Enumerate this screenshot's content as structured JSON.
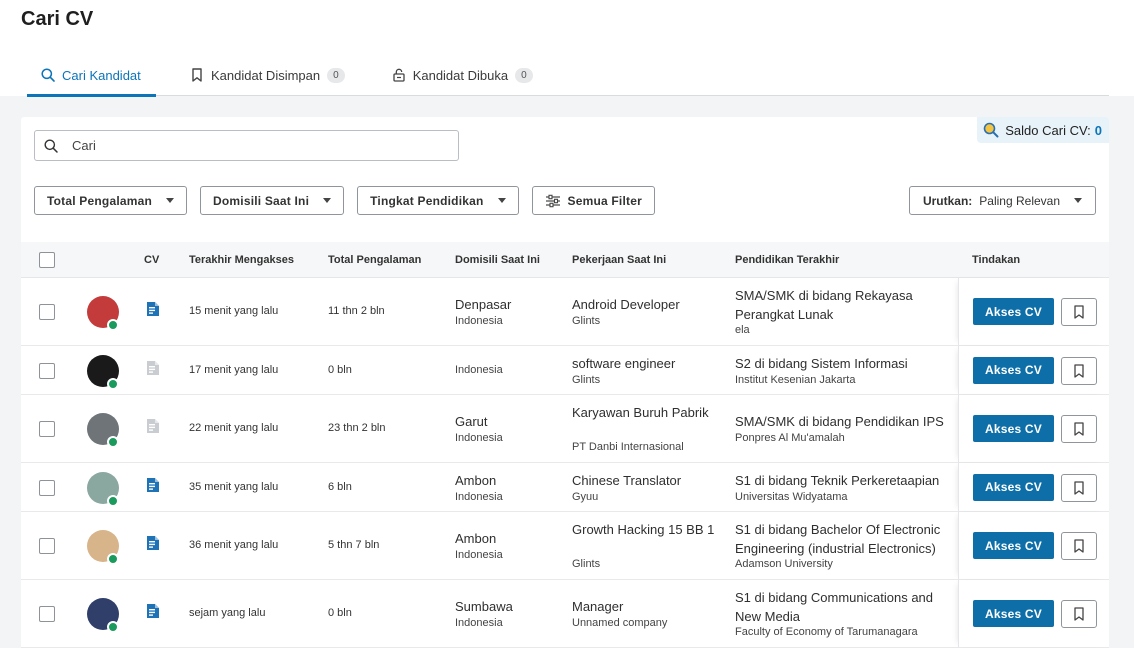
{
  "page": {
    "title": "Cari CV"
  },
  "tabs": [
    {
      "label": "Cari Kandidat",
      "active": true,
      "icon": "search-icon"
    },
    {
      "label": "Kandidat Disimpan",
      "count": "0",
      "icon": "bookmark-icon"
    },
    {
      "label": "Kandidat Dibuka",
      "count": "0",
      "icon": "unlock-icon"
    }
  ],
  "saldo": {
    "label": "Saldo Cari CV:",
    "value": "0",
    "icon": "search-coin-icon"
  },
  "search": {
    "placeholder": "Cari"
  },
  "filters": {
    "experience": "Total Pengalaman",
    "domicile": "Domisili Saat Ini",
    "education": "Tingkat Pendidikan",
    "all": "Semua Filter"
  },
  "sort": {
    "label": "Urutkan:",
    "value": "Paling Relevan"
  },
  "columns": {
    "cv": "CV",
    "last_access": "Terakhir Mengakses",
    "experience": "Total Pengalaman",
    "domicile": "Domisili Saat Ini",
    "job": "Pekerjaan Saat Ini",
    "education": "Pendidikan Terakhir",
    "action": "Tindakan"
  },
  "actions": {
    "access_cv": "Akses CV"
  },
  "colors": {
    "accent": "#0c74b8",
    "button": "#0e6fa8",
    "online": "#1a9a5c",
    "cv_active": "#1d73b6",
    "cv_inactive": "#c9ccd0"
  },
  "rows": [
    {
      "cv_available": true,
      "last_access": "15 menit yang lalu",
      "experience": "11 thn 2 bln",
      "city": "Denpasar",
      "country": "Indonesia",
      "job_title": "Android Developer",
      "company": "Glints",
      "education": "SMA/SMK di bidang Rekayasa Perangkat Lunak",
      "school": "ela",
      "avatar_color": "#c43b3b"
    },
    {
      "cv_available": false,
      "last_access": "17 menit yang lalu",
      "experience": "0 bln",
      "city": "",
      "country": "Indonesia",
      "job_title": "software engineer",
      "company": "Glints",
      "education": "S2 di bidang Sistem Informasi",
      "school": "Institut Kesenian Jakarta",
      "avatar_color": "#1a1a1a"
    },
    {
      "cv_available": false,
      "last_access": "22 menit yang lalu",
      "experience": "23 thn 2 bln",
      "city": "Garut",
      "country": "Indonesia",
      "job_title": "Karyawan Buruh Pabrik",
      "company": "PT Danbi Internasional",
      "education": "SMA/SMK di bidang Pendidikan IPS",
      "school": "Ponpres Al Mu'amalah",
      "avatar_color": "#6f7478"
    },
    {
      "cv_available": true,
      "last_access": "35 menit yang lalu",
      "experience": "6 bln",
      "city": "Ambon",
      "country": "Indonesia",
      "job_title": "Chinese Translator",
      "company": "Gyuu",
      "education": "S1 di bidang Teknik Perkeretaapian",
      "school": "Universitas Widyatama",
      "avatar_color": "#8aa7a0"
    },
    {
      "cv_available": true,
      "last_access": "36 menit yang lalu",
      "experience": "5 thn 7 bln",
      "city": "Ambon",
      "country": "Indonesia",
      "job_title": "Growth Hacking 15 BB 1",
      "company": "Glints",
      "education": "S1 di bidang Bachelor Of Electronic Engineering (industrial Electronics)",
      "school": "Adamson University",
      "avatar_color": "#d7b48a"
    },
    {
      "cv_available": true,
      "last_access": "sejam yang lalu",
      "experience": "0 bln",
      "city": "Sumbawa",
      "country": "Indonesia",
      "job_title": "Manager",
      "company": "Unnamed company",
      "education": "S1 di bidang Communications and New Media",
      "school": "Faculty of Economy of Tarumanagara",
      "avatar_color": "#2f3f6a"
    }
  ]
}
